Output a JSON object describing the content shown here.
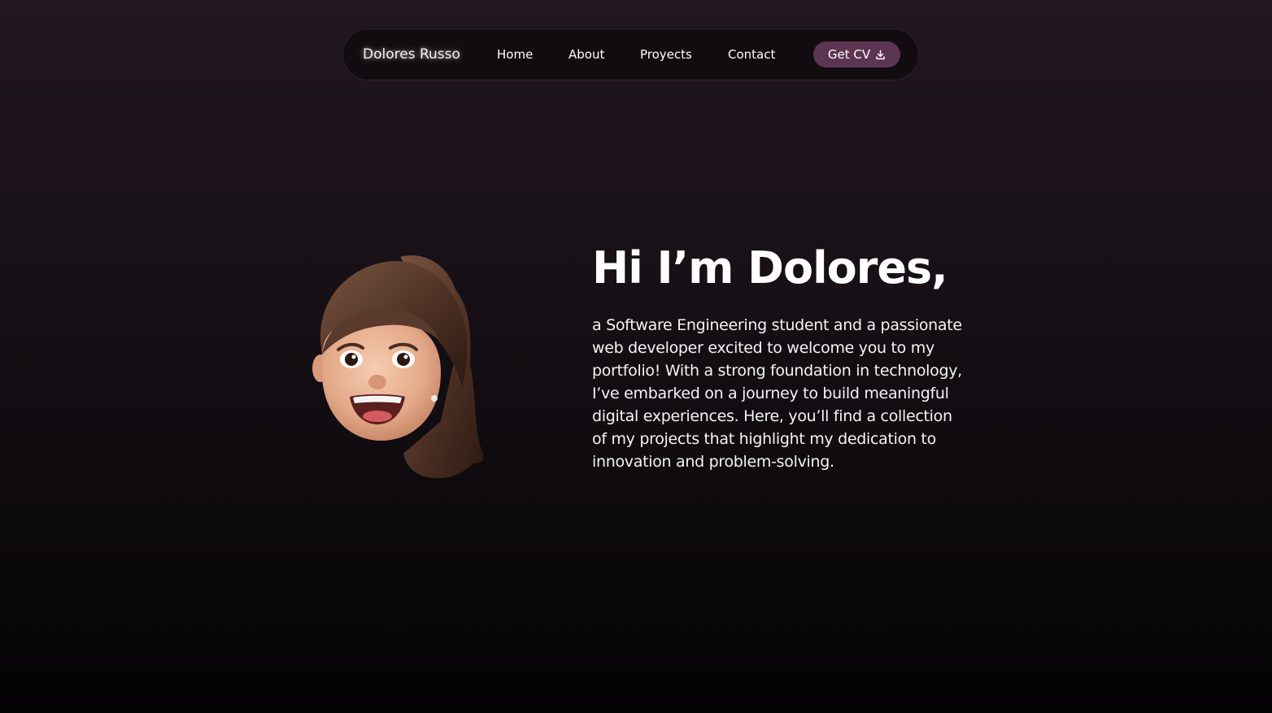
{
  "nav": {
    "brand": "Dolores Russo",
    "links": [
      "Home",
      "About",
      "Proyects",
      "Contact"
    ],
    "cv_button": "Get CV",
    "cv_icon": "download-icon"
  },
  "hero": {
    "avatar": "memoji-avatar",
    "title": "Hi I’m Dolores,",
    "description": "a Software Engineering student and a passionate web developer excited to welcome you to my portfolio! With a strong foundation in technology, I’ve embarked on a journey to build meaningful digital experiences. Here, you’ll find a collection of my projects that highlight my dedication to innovation and problem-solving."
  },
  "colors": {
    "accent": "#5c3552",
    "background_top": "#221620",
    "background_bottom": "#030203"
  }
}
